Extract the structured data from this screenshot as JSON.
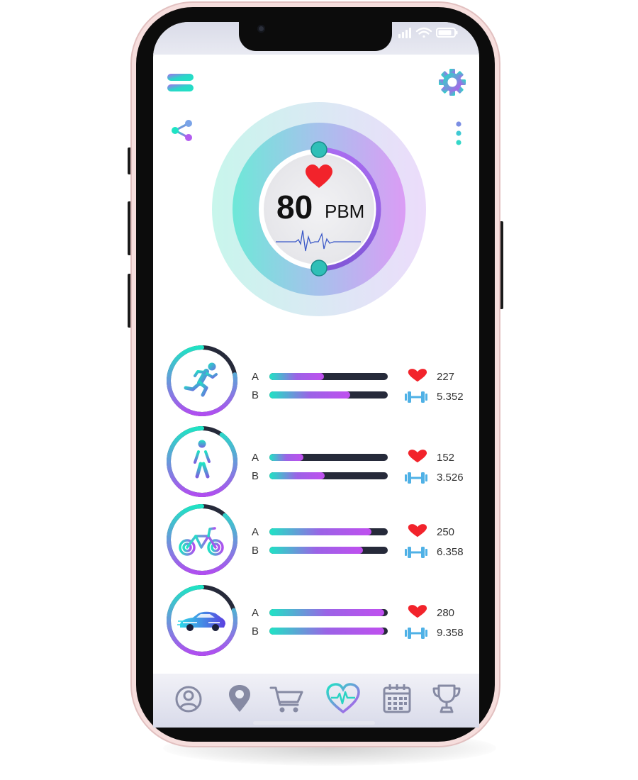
{
  "colors": {
    "accent_start": "#1fe3c4",
    "accent_end": "#c04fef",
    "heart": "#f2232b",
    "bar_track": "#262a3a",
    "nav_icon": "#868aa3"
  },
  "header": {
    "menu_icon": "hamburger-icon",
    "settings_icon": "gear-icon",
    "share_icon": "share-icon",
    "more_icon": "vertical-dots-icon"
  },
  "heart_rate": {
    "value": "80",
    "unit": "PBM",
    "icon": "heart-icon",
    "progress_fraction": 0.5
  },
  "activities": [
    {
      "name": "running",
      "icon": "runner-icon",
      "ring_fraction": 0.78,
      "a_label": "A",
      "b_label": "B",
      "a_fraction": 0.46,
      "b_fraction": 0.68,
      "heart_value": "227",
      "weight_value": "5.352"
    },
    {
      "name": "walking",
      "icon": "walker-icon",
      "ring_fraction": 0.9,
      "a_label": "A",
      "b_label": "B",
      "a_fraction": 0.29,
      "b_fraction": 0.47,
      "heart_value": "152",
      "weight_value": "3.526"
    },
    {
      "name": "cycling",
      "icon": "bicycle-icon",
      "ring_fraction": 0.88,
      "a_label": "A",
      "b_label": "B",
      "a_fraction": 0.86,
      "b_fraction": 0.79,
      "heart_value": "250",
      "weight_value": "6.358"
    },
    {
      "name": "driving",
      "icon": "car-icon",
      "ring_fraction": 0.8,
      "a_label": "A",
      "b_label": "B",
      "a_fraction": 0.97,
      "b_fraction": 0.97,
      "heart_value": "280",
      "weight_value": "9.358"
    }
  ],
  "bottom_nav": [
    {
      "icon": "profile-icon"
    },
    {
      "icon": "location-pin-icon"
    },
    {
      "icon": "cart-icon"
    },
    {
      "icon": "heart-rate-icon",
      "active": true
    },
    {
      "icon": "calendar-icon"
    },
    {
      "icon": "trophy-icon"
    }
  ]
}
